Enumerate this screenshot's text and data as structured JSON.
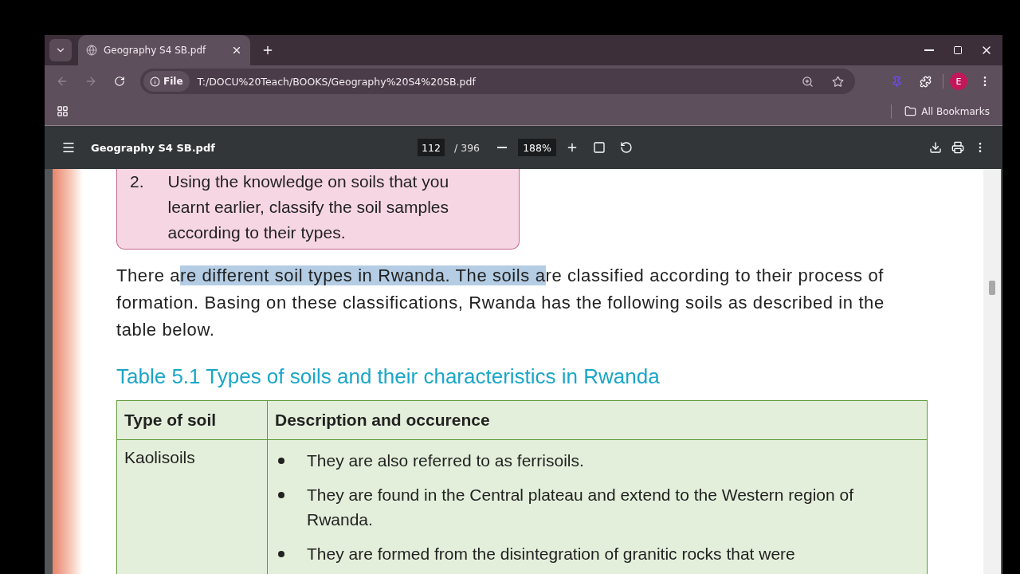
{
  "tab": {
    "title": "Geography S4 SB.pdf",
    "selected": true
  },
  "address_bar": {
    "scheme_chip": "File",
    "url": "T:/DOCU%20Teach/BOOKS/Geography%20S4%20SB.pdf"
  },
  "profile": {
    "initial": "E"
  },
  "bookmarks_bar": {
    "folder": "All Bookmarks"
  },
  "pdf_toolbar": {
    "title": "Geography S4 SB.pdf",
    "page": "112",
    "page_total": "/ 396",
    "zoom": "188%"
  },
  "activity_box": {
    "number": "2.",
    "lines": [
      "Using the knowledge on soils that you",
      "learnt earlier, classify the soil samples",
      "according to their types."
    ]
  },
  "paragraph": {
    "before": "There a",
    "selected_text": "re different soil types in Rwanda. The soils a",
    "after": "re classified according to their process of formation. Basing on these classifications, Rwanda has the following soils as described in the table below."
  },
  "table_title": "Table 5.1 Types of soils and their characteristics in Rwanda",
  "table": {
    "columns": [
      "Type of soil",
      "Description and occurence"
    ],
    "rows": [
      {
        "type": "Kaolisoils",
        "bullets": [
          "They are also referred to as ferrisoils.",
          "They are found in the Central plateau and extend to the Western region of Rwanda.",
          "They are formed from the disintegration of granitic rocks that were"
        ]
      }
    ]
  }
}
